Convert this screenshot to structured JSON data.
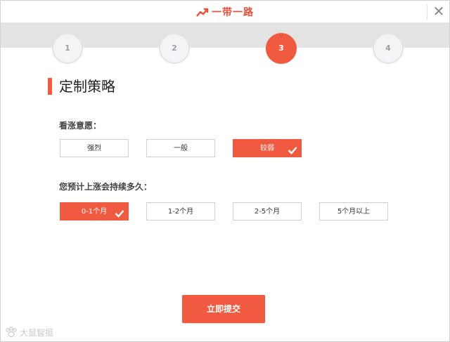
{
  "window": {
    "title": "一带一路",
    "close_glyph": "✕"
  },
  "steps": [
    {
      "label": "1",
      "active": false
    },
    {
      "label": "2",
      "active": false
    },
    {
      "label": "3",
      "active": true
    },
    {
      "label": "4",
      "active": false
    }
  ],
  "section_title": "定制策略",
  "q1": {
    "label": "看涨意愿：",
    "options": [
      "强烈",
      "一般",
      "较弱"
    ],
    "selected": "较弱"
  },
  "q2": {
    "label": "您预计上涨会持续多久：",
    "options": [
      "0-1个月",
      "1-2个月",
      "2-5个月",
      "5个月以上"
    ],
    "selected": "0-1个月"
  },
  "submit_label": "立即提交",
  "watermark": "大鼠智挺",
  "colors": {
    "accent": "#f05a40",
    "step_inactive_bg": "#f3f4f6",
    "band_bg": "#e3e3e3"
  }
}
